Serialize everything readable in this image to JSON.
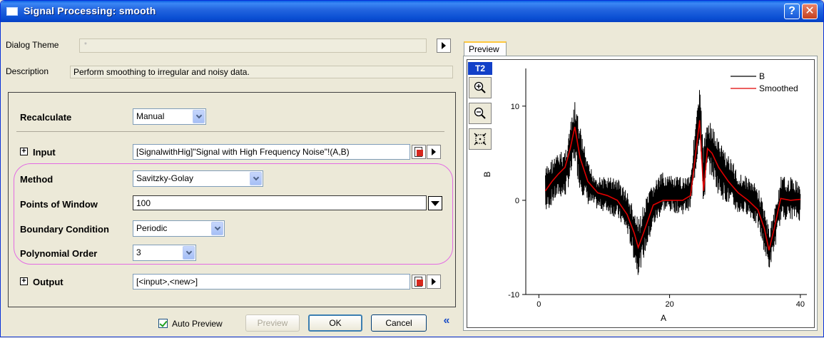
{
  "window": {
    "title": "Signal Processing: smooth",
    "help_label": "?",
    "close_label": "✕"
  },
  "theme": {
    "label": "Dialog Theme",
    "value": "*"
  },
  "description": {
    "label": "Description",
    "text": "Perform smoothing to irregular and noisy data."
  },
  "form": {
    "recalculate": {
      "label": "Recalculate",
      "value": "Manual"
    },
    "input": {
      "label": "Input",
      "value": "[SignalwithHig]\"Signal with High Frequency Noise\"!(A,B)"
    },
    "method": {
      "label": "Method",
      "value": "Savitzky-Golay"
    },
    "points": {
      "label": "Points of Window",
      "value": "100"
    },
    "boundary": {
      "label": "Boundary Condition",
      "value": "Periodic"
    },
    "poly": {
      "label": "Polynomial Order",
      "value": "3"
    },
    "output": {
      "label": "Output",
      "value": "[<input>,<new>]"
    },
    "expand_symbol": "+"
  },
  "buttons": {
    "auto_preview": "Auto Preview",
    "preview": "Preview",
    "ok": "OK",
    "cancel": "Cancel",
    "collapse": "«"
  },
  "preview_tab": {
    "label": "Preview",
    "layer": "T2"
  },
  "colors": {
    "accent": "#0a4fd3",
    "smoothed": "#e00000",
    "highlight": "#e36be3"
  },
  "chart_data": {
    "type": "line",
    "xlabel": "A",
    "ylabel": "B",
    "xlim": [
      -2,
      41
    ],
    "ylim": [
      -10,
      14
    ],
    "xticks": [
      "0",
      "20",
      "40"
    ],
    "yticks": [
      "-10",
      "0",
      "10"
    ],
    "legend_placement": "top-right",
    "series": [
      {
        "name": "B",
        "color": "#000000",
        "style": "noisy band",
        "x": [
          1,
          2,
          3,
          4,
          4.8,
          5.5,
          6.3,
          7.5,
          9,
          10.5,
          12,
          13.5,
          14.6,
          15.2,
          16,
          17.5,
          19,
          20.5,
          22,
          23.2,
          24,
          24.6,
          25.2,
          25.8,
          26.5,
          27.5,
          29,
          30.5,
          32,
          33.5,
          34.5,
          35.2,
          36,
          37,
          38.5,
          40
        ],
        "low": [
          -1.5,
          -0.5,
          0.3,
          0.2,
          2,
          4,
          1,
          -0.5,
          -1,
          -1.3,
          -2,
          -3.5,
          -6.5,
          -8,
          -6.3,
          -3,
          -1.2,
          -1.3,
          -1.5,
          -1,
          3,
          6.5,
          -1,
          3,
          2.5,
          0.5,
          -0.5,
          -1.5,
          -1.5,
          -3,
          -5.5,
          -7.5,
          -5.5,
          -2.2,
          -2,
          -2.2
        ],
        "high": [
          3.5,
          4.5,
          5,
          5.5,
          8,
          10.5,
          8,
          4,
          2.5,
          2.5,
          2.5,
          1,
          -1,
          -2,
          -0.5,
          2,
          3,
          2.5,
          2.5,
          3,
          8.5,
          12,
          6,
          9,
          8,
          6.5,
          5,
          3,
          2.5,
          1.5,
          -0.5,
          -3,
          -1,
          2.5,
          2.5,
          2
        ]
      },
      {
        "name": "Smoothed",
        "color": "#e00000",
        "x": [
          1,
          2,
          3,
          4,
          4.8,
          5.5,
          6.3,
          7.5,
          9,
          10.5,
          12,
          13.5,
          14.6,
          15.2,
          16,
          17.5,
          19,
          20.5,
          22,
          23.2,
          24,
          24.6,
          25.2,
          25.8,
          26.5,
          27.5,
          29,
          30.5,
          32,
          33.5,
          34.5,
          35.2,
          36,
          37,
          38.5,
          40
        ],
        "y": [
          1,
          2,
          2.8,
          3.5,
          5.5,
          7.8,
          4.5,
          2,
          0.8,
          0.5,
          0,
          -1.5,
          -3.5,
          -5,
          -3.5,
          -0.5,
          0,
          0,
          0,
          0.5,
          5,
          8.5,
          1,
          5.5,
          5,
          3.5,
          2,
          0.8,
          0,
          -1,
          -3,
          -5.3,
          -3,
          0.2,
          0,
          0.1
        ]
      }
    ]
  }
}
